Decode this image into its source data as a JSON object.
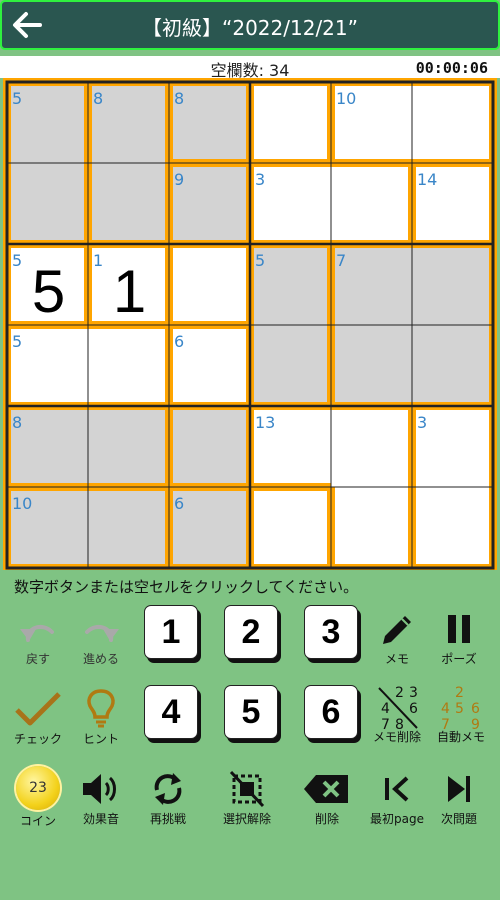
{
  "header": {
    "title": "【初級】“2022/12/21”"
  },
  "status": {
    "blank_count": "空欄数: 34",
    "timer": "00:00:06"
  },
  "prompt": "数字ボタンまたは空セルをクリックしてください。",
  "grid": {
    "rows": 6,
    "cols": 6,
    "shaded": [
      [
        1,
        1,
        1,
        0,
        0,
        0
      ],
      [
        1,
        1,
        1,
        0,
        0,
        0
      ],
      [
        0,
        0,
        0,
        1,
        1,
        1
      ],
      [
        0,
        0,
        0,
        1,
        1,
        1
      ],
      [
        1,
        1,
        1,
        0,
        0,
        0
      ],
      [
        1,
        1,
        1,
        0,
        0,
        0
      ]
    ],
    "values": [
      [
        "",
        "",
        "",
        "",
        "",
        ""
      ],
      [
        "",
        "",
        "",
        "",
        "",
        ""
      ],
      [
        "5",
        "1",
        "",
        "",
        "",
        ""
      ],
      [
        "",
        "",
        "",
        "",
        "",
        ""
      ],
      [
        "",
        "",
        "",
        "",
        "",
        ""
      ],
      [
        "",
        "",
        "",
        "",
        "",
        ""
      ]
    ],
    "cages": [
      {
        "sum": "5",
        "cells": [
          [
            0,
            0
          ],
          [
            1,
            0
          ]
        ]
      },
      {
        "sum": "8",
        "cells": [
          [
            0,
            1
          ],
          [
            1,
            1
          ]
        ]
      },
      {
        "sum": "8",
        "cells": [
          [
            0,
            2
          ]
        ]
      },
      {
        "sum": "",
        "cells": [
          [
            0,
            3
          ]
        ]
      },
      {
        "sum": "10",
        "cells": [
          [
            0,
            4
          ],
          [
            0,
            5
          ]
        ]
      },
      {
        "sum": "9",
        "cells": [
          [
            1,
            2
          ]
        ]
      },
      {
        "sum": "3",
        "cells": [
          [
            1,
            3
          ],
          [
            1,
            4
          ]
        ]
      },
      {
        "sum": "14",
        "cells": [
          [
            1,
            5
          ]
        ]
      },
      {
        "sum": "5",
        "cells": [
          [
            2,
            0
          ]
        ]
      },
      {
        "sum": "1",
        "cells": [
          [
            2,
            1
          ]
        ]
      },
      {
        "sum": "",
        "cells": [
          [
            2,
            2
          ]
        ]
      },
      {
        "sum": "5",
        "cells": [
          [
            2,
            3
          ],
          [
            3,
            3
          ]
        ]
      },
      {
        "sum": "7",
        "cells": [
          [
            2,
            4
          ],
          [
            2,
            5
          ],
          [
            3,
            4
          ],
          [
            3,
            5
          ]
        ]
      },
      {
        "sum": "5",
        "cells": [
          [
            3,
            0
          ],
          [
            3,
            1
          ]
        ]
      },
      {
        "sum": "6",
        "cells": [
          [
            3,
            2
          ]
        ]
      },
      {
        "sum": "8",
        "cells": [
          [
            4,
            0
          ],
          [
            4,
            1
          ]
        ]
      },
      {
        "sum": "",
        "cells": [
          [
            4,
            2
          ]
        ]
      },
      {
        "sum": "13",
        "cells": [
          [
            4,
            3
          ],
          [
            4,
            4
          ],
          [
            5,
            4
          ]
        ]
      },
      {
        "sum": "3",
        "cells": [
          [
            4,
            5
          ],
          [
            5,
            5
          ]
        ]
      },
      {
        "sum": "10",
        "cells": [
          [
            5,
            0
          ],
          [
            5,
            1
          ]
        ]
      },
      {
        "sum": "6",
        "cells": [
          [
            5,
            2
          ]
        ]
      },
      {
        "sum": "",
        "cells": [
          [
            5,
            3
          ]
        ]
      }
    ]
  },
  "tools": {
    "undo": "戻す",
    "redo": "進める",
    "memo": "メモ",
    "pause": "ポーズ",
    "check": "チェック",
    "hint": "ヒント",
    "memo_clear": "メモ削除",
    "auto_memo": "自動メモ",
    "coin": "コイン",
    "coin_count": "23",
    "sound": "効果音",
    "retry": "再挑戦",
    "deselect": "選択解除",
    "delete": "削除",
    "first_page": "最初page",
    "next_problem": "次問題"
  },
  "number_buttons": [
    "1",
    "2",
    "3",
    "4",
    "5",
    "6"
  ],
  "memo_clear_icon_digits": [
    "2",
    "3",
    "4",
    "6",
    "7",
    "8"
  ],
  "auto_memo_icon_digits": [
    "2",
    "4",
    "5",
    "6",
    "7",
    "9"
  ],
  "colors": {
    "background": "#7fc383",
    "header": "#2a5650",
    "header_border": "#2ff13f",
    "cage_fill": "#ffa500",
    "shaded_cell": "#d3d3d3",
    "sum_text": "#3a86c8",
    "hint_icon": "#b07a12",
    "auto_memo_digits": "#b07a12"
  }
}
